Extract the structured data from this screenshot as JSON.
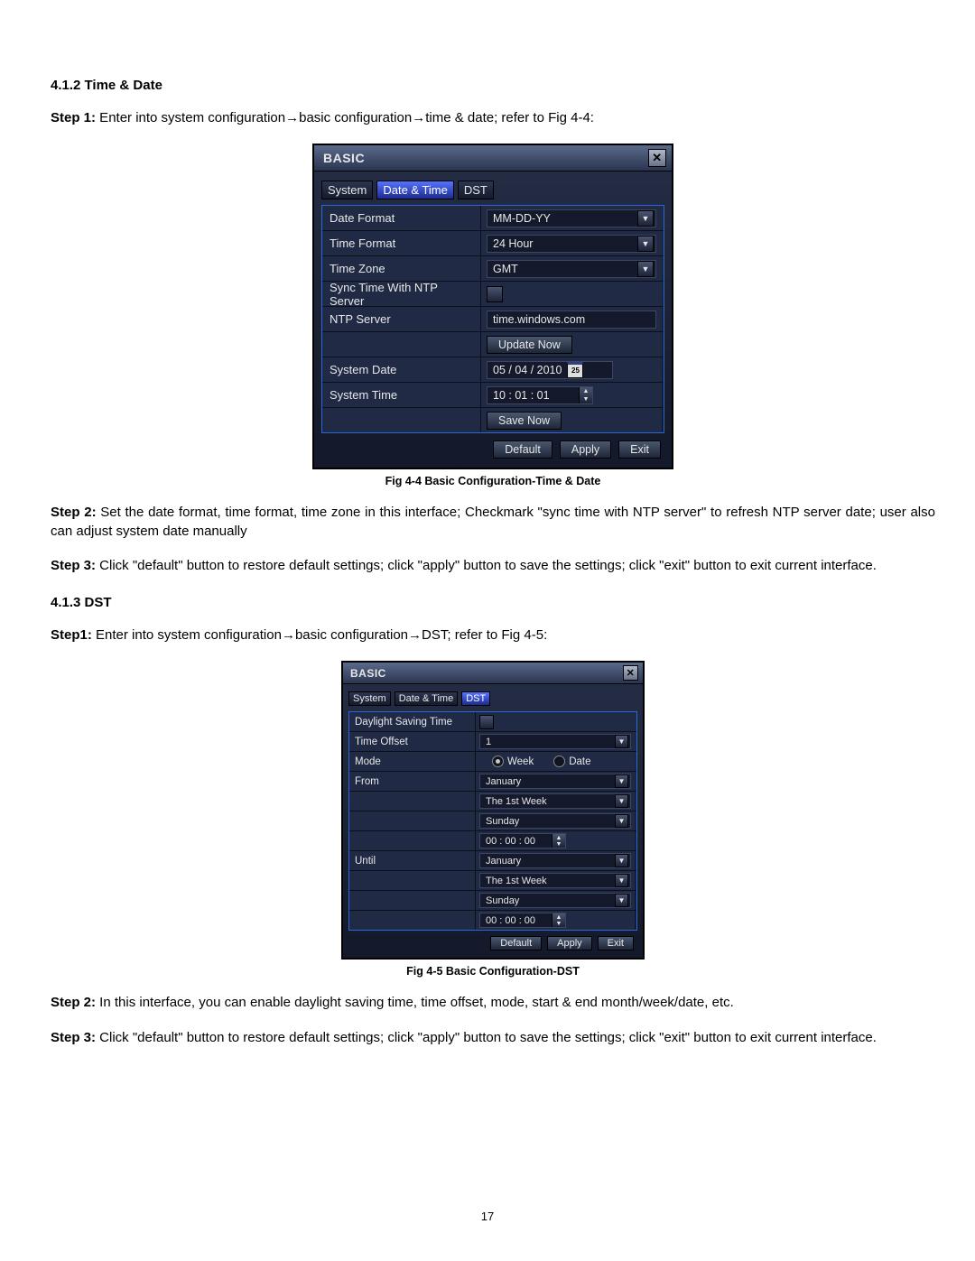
{
  "section1": {
    "heading": "4.1.2 Time & Date",
    "step1_lbl": "Step 1:",
    "step1_a": " Enter into system configuration",
    "step1_b": "basic configuration",
    "step1_c": "time & date; refer to Fig 4-4:",
    "caption": "Fig 4-4 Basic Configuration-Time & Date",
    "step2_lbl": "Step 2:",
    "step2_txt": " Set the date format, time format, time zone in this interface; Checkmark \"sync time with NTP server\" to refresh NTP server date; user also can adjust system date manually",
    "step3_lbl": "Step 3:",
    "step3_txt": " Click \"default\" button to restore default settings; click \"apply\" button to save the settings; click \"exit\" button to exit current interface."
  },
  "section2": {
    "heading": "4.1.3 DST",
    "step1_lbl": "Step1:",
    "step1_a": " Enter into system configuration",
    "step1_b": "basic configuration",
    "step1_c": "DST; refer to Fig 4-5:",
    "caption": "Fig 4-5 Basic Configuration-DST",
    "step2_lbl": "Step 2:",
    "step2_txt": " In this interface, you can enable daylight saving time, time offset, mode, start & end month/week/date, etc.",
    "step3_lbl": "Step 3:",
    "step3_txt": " Click \"default\" button to restore default settings; click \"apply\" button to save the settings; click \"exit\" button to exit current interface."
  },
  "arrow_glyph": "→",
  "panel1": {
    "title": "BASIC",
    "tabs": [
      "System",
      "Date & Time",
      "DST"
    ],
    "tab_selected": 1,
    "rows": {
      "date_format_lbl": "Date Format",
      "date_format_val": "MM-DD-YY",
      "time_format_lbl": "Time Format",
      "time_format_val": "24 Hour",
      "time_zone_lbl": "Time Zone",
      "time_zone_val": "GMT",
      "sync_lbl": "Sync Time With NTP Server",
      "ntp_lbl": "NTP Server",
      "ntp_val": "time.windows.com",
      "update_btn": "Update Now",
      "sysdate_lbl": "System Date",
      "sysdate_val": "05 / 04 / 2010",
      "cal_icon": "25",
      "systime_lbl": "System Time",
      "systime_val": "10 : 01 : 01",
      "save_btn": "Save Now"
    },
    "footer": {
      "default": "Default",
      "apply": "Apply",
      "exit": "Exit"
    }
  },
  "panel2": {
    "title": "BASIC",
    "tabs": [
      "System",
      "Date & Time",
      "DST"
    ],
    "tab_selected": 2,
    "rows": {
      "dst_lbl": "Daylight Saving Time",
      "offset_lbl": "Time Offset",
      "offset_val": "1",
      "mode_lbl": "Mode",
      "mode_week": "Week",
      "mode_date": "Date",
      "from_lbl": "From",
      "from_month": "January",
      "from_week": "The 1st Week",
      "from_day": "Sunday",
      "from_time": "00 : 00 : 00",
      "until_lbl": "Until",
      "until_month": "January",
      "until_week": "The 1st Week",
      "until_day": "Sunday",
      "until_time": "00 : 00 : 00"
    },
    "footer": {
      "default": "Default",
      "apply": "Apply",
      "exit": "Exit"
    }
  },
  "page_number": "17"
}
